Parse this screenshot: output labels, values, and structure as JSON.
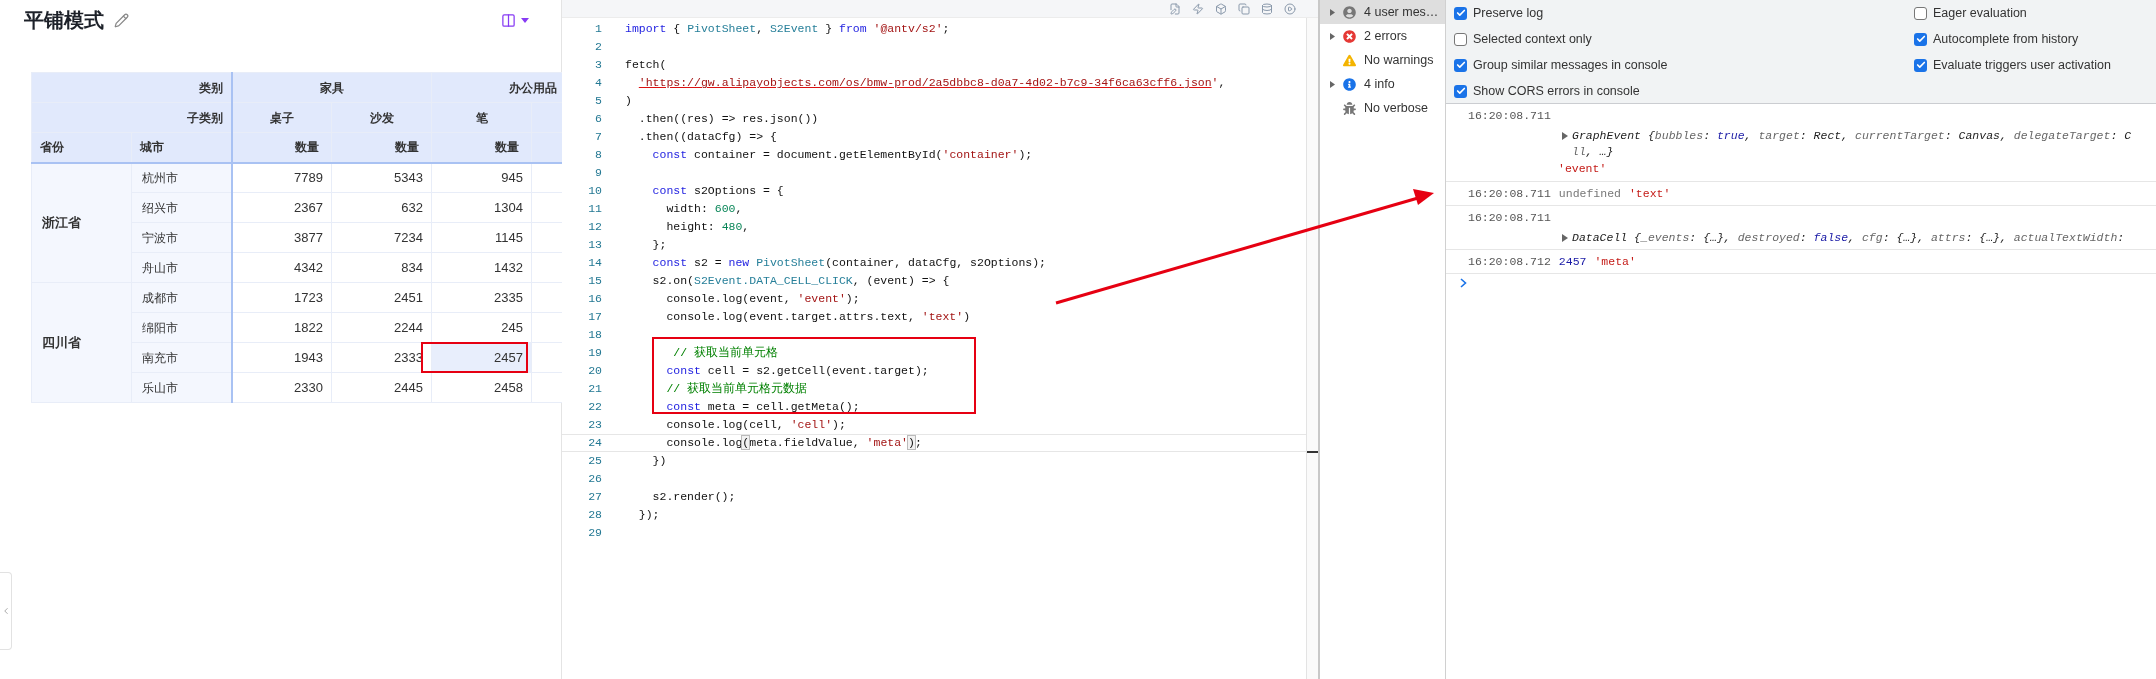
{
  "left_panel": {
    "title": "平铺模式",
    "table": {
      "corner_labels": [
        "类别",
        "子类别"
      ],
      "row_header_columns": [
        "省份",
        "城市"
      ],
      "column_groups": [
        {
          "label": "家具",
          "subcategories": [
            "桌子",
            "沙发"
          ]
        },
        {
          "label": "办公用品",
          "subcategories": [
            "笔"
          ]
        }
      ],
      "measure_labels": [
        "数量",
        "数量",
        "数量"
      ],
      "row_groups": [
        {
          "province": "浙江省",
          "rows": [
            {
              "city": "杭州市",
              "values": [
                {
                  "text": "7789",
                  "selected": false
                },
                {
                  "text": "5343",
                  "selected": false
                },
                {
                  "text": "945",
                  "selected": false
                }
              ]
            },
            {
              "city": "绍兴市",
              "values": [
                {
                  "text": "2367",
                  "selected": false
                },
                {
                  "text": "632",
                  "selected": false
                },
                {
                  "text": "1304",
                  "selected": false
                }
              ]
            },
            {
              "city": "宁波市",
              "values": [
                {
                  "text": "3877",
                  "selected": false
                },
                {
                  "text": "7234",
                  "selected": false
                },
                {
                  "text": "1145",
                  "selected": false
                }
              ]
            },
            {
              "city": "舟山市",
              "values": [
                {
                  "text": "4342",
                  "selected": false
                },
                {
                  "text": "834",
                  "selected": false
                },
                {
                  "text": "1432",
                  "selected": false
                }
              ]
            }
          ]
        },
        {
          "province": "四川省",
          "rows": [
            {
              "city": "成都市",
              "values": [
                {
                  "text": "1723",
                  "selected": false
                },
                {
                  "text": "2451",
                  "selected": false
                },
                {
                  "text": "2335",
                  "selected": false
                }
              ]
            },
            {
              "city": "绵阳市",
              "values": [
                {
                  "text": "1822",
                  "selected": false
                },
                {
                  "text": "2244",
                  "selected": false
                },
                {
                  "text": "245",
                  "selected": false
                }
              ]
            },
            {
              "city": "南充市",
              "values": [
                {
                  "text": "1943",
                  "selected": false
                },
                {
                  "text": "2333",
                  "selected": false
                },
                {
                  "text": "2457",
                  "selected": true
                }
              ]
            },
            {
              "city": "乐山市",
              "values": [
                {
                  "text": "2330",
                  "selected": false
                },
                {
                  "text": "2445",
                  "selected": false
                },
                {
                  "text": "2458",
                  "selected": false
                }
              ]
            }
          ]
        }
      ]
    }
  },
  "editor": {
    "lines": [
      {
        "number": "1",
        "current": false,
        "tokens": [
          {
            "kind": "keyword",
            "text": "import"
          },
          {
            "kind": "plain",
            "text": " { "
          },
          {
            "kind": "type",
            "text": "PivotSheet"
          },
          {
            "kind": "plain",
            "text": ", "
          },
          {
            "kind": "type",
            "text": "S2Event"
          },
          {
            "kind": "plain",
            "text": " } "
          },
          {
            "kind": "keyword",
            "text": "from "
          },
          {
            "kind": "string",
            "text": "'@antv/s2'"
          },
          {
            "kind": "plain",
            "text": ";"
          }
        ]
      },
      {
        "number": "2",
        "current": false
      },
      {
        "number": "3",
        "current": false,
        "tokens": [
          {
            "kind": "plain",
            "text": "fetch("
          }
        ]
      },
      {
        "number": "4",
        "current": false,
        "tokens": [
          {
            "kind": "link",
            "text": "  'https://gw.alipayobjects.com/os/bmw-prod/2a5dbbc8-d0a7-4d02-b7c9-34f6ca63cff6.json"
          },
          {
            "kind": "string",
            "text": "'"
          },
          {
            "kind": "plain",
            "text": ","
          }
        ]
      },
      {
        "number": "5",
        "current": false,
        "tokens": [
          {
            "kind": "plain",
            "text": ")"
          }
        ]
      },
      {
        "number": "6",
        "current": false,
        "tokens": [
          {
            "kind": "plain",
            "text": "  .then((res) => res.json())"
          }
        ]
      },
      {
        "number": "7",
        "current": false,
        "tokens": [
          {
            "kind": "plain",
            "text": "  .then((dataCfg) => {"
          }
        ]
      },
      {
        "number": "8",
        "current": false,
        "tokens": [
          {
            "kind": "keyword",
            "text": "    const"
          },
          {
            "kind": "plain",
            "text": " container = document.getElementById("
          },
          {
            "kind": "string",
            "text": "'container'"
          },
          {
            "kind": "plain",
            "text": ");"
          }
        ]
      },
      {
        "number": "9",
        "current": false
      },
      {
        "number": "10",
        "current": false,
        "tokens": [
          {
            "kind": "keyword",
            "text": "    const"
          },
          {
            "kind": "plain",
            "text": " s2Options = {"
          }
        ]
      },
      {
        "number": "11",
        "current": false,
        "tokens": [
          {
            "kind": "plain",
            "text": "      width: "
          },
          {
            "kind": "number",
            "text": "600"
          },
          {
            "kind": "plain",
            "text": ","
          }
        ]
      },
      {
        "number": "12",
        "current": false,
        "tokens": [
          {
            "kind": "plain",
            "text": "      height: "
          },
          {
            "kind": "number",
            "text": "480"
          },
          {
            "kind": "plain",
            "text": ","
          }
        ]
      },
      {
        "number": "13",
        "current": false,
        "tokens": [
          {
            "kind": "plain",
            "text": "    };"
          }
        ]
      },
      {
        "number": "14",
        "current": false,
        "tokens": [
          {
            "kind": "keyword",
            "text": "    const"
          },
          {
            "kind": "plain",
            "text": " s2 = "
          },
          {
            "kind": "keyword",
            "text": "new "
          },
          {
            "kind": "type",
            "text": "PivotSheet"
          },
          {
            "kind": "plain",
            "text": "(container, dataCfg, s2Options);"
          }
        ]
      },
      {
        "number": "15",
        "current": false,
        "tokens": [
          {
            "kind": "plain",
            "text": "    s2.on("
          },
          {
            "kind": "type",
            "text": "S2Event.DATA_CELL_CLICK"
          },
          {
            "kind": "plain",
            "text": ", (event) => {"
          }
        ]
      },
      {
        "number": "16",
        "current": false,
        "tokens": [
          {
            "kind": "plain",
            "text": "      console.log(event, "
          },
          {
            "kind": "string",
            "text": "'event'"
          },
          {
            "kind": "plain",
            "text": ");"
          }
        ]
      },
      {
        "number": "17",
        "current": false,
        "tokens": [
          {
            "kind": "plain",
            "text": "      console.log(event.target.attrs.text, "
          },
          {
            "kind": "string",
            "text": "'text'"
          },
          {
            "kind": "plain",
            "text": ")"
          }
        ]
      },
      {
        "number": "18",
        "current": false
      },
      {
        "number": "19",
        "current": false,
        "tokens": [
          {
            "kind": "comment",
            "text": "       // 获取当前单元格"
          }
        ]
      },
      {
        "number": "20",
        "current": false,
        "tokens": [
          {
            "kind": "keyword",
            "text": "      const"
          },
          {
            "kind": "plain",
            "text": " cell = s2.getCell(event.target);"
          }
        ]
      },
      {
        "number": "21",
        "current": false,
        "tokens": [
          {
            "kind": "comment",
            "text": "      // 获取当前单元格元数据"
          }
        ]
      },
      {
        "number": "22",
        "current": false,
        "tokens": [
          {
            "kind": "keyword",
            "text": "      const"
          },
          {
            "kind": "plain",
            "text": " meta = cell.getMeta();"
          }
        ]
      },
      {
        "number": "23",
        "current": false,
        "tokens": [
          {
            "kind": "plain",
            "text": "      console.log(cell, "
          },
          {
            "kind": "string",
            "text": "'cell'"
          },
          {
            "kind": "plain",
            "text": ");"
          }
        ]
      },
      {
        "number": "24",
        "current": true,
        "tokens": [
          {
            "kind": "plain",
            "text": "      console.log"
          },
          {
            "kind": "matched",
            "text": "("
          },
          {
            "kind": "plain",
            "text": "meta.fieldValue, "
          },
          {
            "kind": "string",
            "text": "'meta'"
          },
          {
            "kind": "matched",
            "text": ")"
          },
          {
            "kind": "plain",
            "text": ";"
          }
        ]
      },
      {
        "number": "25",
        "current": false,
        "tokens": [
          {
            "kind": "plain",
            "text": "    })"
          }
        ]
      },
      {
        "number": "26",
        "current": false
      },
      {
        "number": "27",
        "current": false,
        "tokens": [
          {
            "kind": "plain",
            "text": "    s2.render();"
          }
        ]
      },
      {
        "number": "28",
        "current": false,
        "tokens": [
          {
            "kind": "plain",
            "text": "  });"
          }
        ]
      },
      {
        "number": "29",
        "current": false
      }
    ]
  },
  "devtools": {
    "sidebar": [
      {
        "kind": "user",
        "label": "4 user mes…",
        "selected": true,
        "expandable": true
      },
      {
        "kind": "error",
        "label": "2 errors",
        "selected": false,
        "expandable": true
      },
      {
        "kind": "warning",
        "label": "No warnings",
        "selected": false,
        "expandable": false
      },
      {
        "kind": "info",
        "label": "4 info",
        "selected": false,
        "expandable": true
      },
      {
        "kind": "verbose",
        "label": "No verbose",
        "selected": false,
        "expandable": false
      }
    ],
    "settings_left": [
      {
        "label": "Preserve log",
        "checked": true
      },
      {
        "label": "Selected context only",
        "checked": false
      },
      {
        "label": "Group similar messages in console",
        "checked": true
      },
      {
        "label": "Show CORS errors in console",
        "checked": true
      }
    ],
    "settings_right": [
      {
        "label": "Eager evaluation",
        "checked": false
      },
      {
        "label": "Autocomplete from history",
        "checked": true
      },
      {
        "label": "Evaluate triggers user activation",
        "checked": true
      }
    ],
    "messages": [
      {
        "time": "16:20:08.711",
        "kind": "object",
        "object_lines": [
          [
            {
              "kind": "name",
              "text": "GraphEvent {"
            },
            {
              "kind": "key",
              "text": "bubbles"
            },
            {
              "kind": "name",
              "text": ": "
            },
            {
              "kind": "value",
              "text": "true"
            },
            {
              "kind": "name",
              "text": ", "
            },
            {
              "kind": "key",
              "text": "target"
            },
            {
              "kind": "name",
              "text": ": Rect, "
            },
            {
              "kind": "key",
              "text": "currentTarget"
            },
            {
              "kind": "name",
              "text": ": Canvas, "
            },
            {
              "kind": "key",
              "text": "delegateTarget"
            },
            {
              "kind": "name",
              "text": ": C"
            }
          ],
          [
            {
              "kind": "key",
              "text": "ll"
            },
            {
              "kind": "name",
              "text": ", …}"
            }
          ]
        ],
        "label": "'event'"
      },
      {
        "time": "16:20:08.711",
        "kind": "inline",
        "parts": [
          {
            "kind": "muted",
            "text": "undefined"
          },
          {
            "kind": "string",
            "text": "'text'"
          }
        ]
      },
      {
        "time": "16:20:08.711",
        "kind": "object",
        "object_lines": [
          [
            {
              "kind": "name",
              "text": "DataCell {"
            },
            {
              "kind": "key",
              "text": "_events"
            },
            {
              "kind": "name",
              "text": ": {…}, "
            },
            {
              "kind": "key",
              "text": "destroyed"
            },
            {
              "kind": "name",
              "text": ": "
            },
            {
              "kind": "value",
              "text": "false"
            },
            {
              "kind": "name",
              "text": ", "
            },
            {
              "kind": "key",
              "text": "cfg"
            },
            {
              "kind": "name",
              "text": ": {…}, "
            },
            {
              "kind": "key",
              "text": "attrs"
            },
            {
              "kind": "name",
              "text": ": {…}, "
            },
            {
              "kind": "key",
              "text": "actualTextWidth"
            },
            {
              "kind": "name",
              "text": ":"
            }
          ]
        ]
      },
      {
        "time": "16:20:08.712",
        "kind": "inline",
        "parts": [
          {
            "kind": "number",
            "text": "2457"
          },
          {
            "kind": "string",
            "text": "'meta'"
          }
        ]
      }
    ]
  }
}
